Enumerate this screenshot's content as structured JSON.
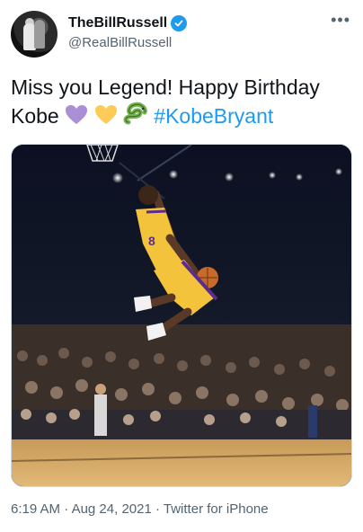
{
  "author": {
    "display_name": "TheBillRussell",
    "handle": "@RealBillRussell",
    "verified": true,
    "verified_color": "#1d9bf0"
  },
  "more_icon": "more-horizontal-icon",
  "tweet": {
    "text_line1": "Miss you Legend! Happy Birthday",
    "text_line2_prefix": "Kobe",
    "emojis": [
      "purple-heart-emoji",
      "yellow-heart-emoji",
      "snake-emoji"
    ],
    "hashtag": "#KobeBryant",
    "hashtag_color": "#1d9bf0"
  },
  "media": {
    "description_icon": "basketball-dunk-photo"
  },
  "meta": {
    "time": "6:19 AM",
    "separator": "·",
    "date": "Aug 24, 2021",
    "source": "Twitter for iPhone"
  }
}
